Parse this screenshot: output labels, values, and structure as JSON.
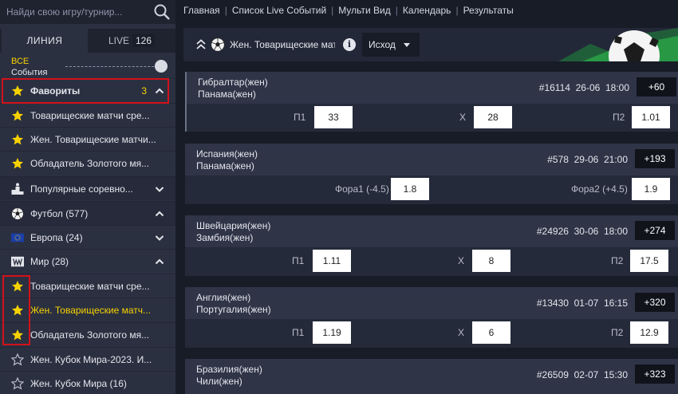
{
  "search": {
    "placeholder": "Найди свою игру/турнир..."
  },
  "tabs": {
    "line": "ЛИНИЯ",
    "live_label": "LIVE",
    "live_count": "126"
  },
  "all_events": {
    "line1": "ВСЕ",
    "line2": "События"
  },
  "sidebar": {
    "favorites": {
      "label": "Фавориты",
      "count": "3"
    },
    "items": [
      {
        "label": "Товарищеские матчи сре...",
        "icon": "star-filled-icon"
      },
      {
        "label": "Жен. Товарищеские матчи...",
        "icon": "star-filled-icon"
      },
      {
        "label": "Обладатель Золотого мя...",
        "icon": "star-filled-icon"
      },
      {
        "label": "Популярные соревно...",
        "icon": "podium-icon"
      },
      {
        "label": "Футбол (577)",
        "icon": "soccer-ball-icon"
      },
      {
        "label": "Европа (24)",
        "icon": "eu-flag-icon"
      },
      {
        "label": "Мир (28)",
        "icon": "world-flag-icon"
      },
      {
        "label": "Товарищеские матчи сре...",
        "icon": "star-filled-icon"
      },
      {
        "label": "Жен. Товарищеские матч...",
        "icon": "star-filled-icon"
      },
      {
        "label": "Обладатель Золотого мя...",
        "icon": "star-filled-icon"
      },
      {
        "label": "Жен. Кубок Мира-2023. И...",
        "icon": "star-outline-icon"
      },
      {
        "label": "Жен. Кубок Мира (16)",
        "icon": "star-outline-icon"
      }
    ]
  },
  "topnav": [
    "Главная",
    "Список Live Событий",
    "Мульти Вид",
    "Календарь",
    "Результаты"
  ],
  "main": {
    "title": "Жен. Товарищеские матч...",
    "info_glyph": "i",
    "select_value": "Исход"
  },
  "matches": [
    {
      "team1": "Гибралтар(жен)",
      "team2": "Панама(жен)",
      "id": "#16114",
      "date": "26-06",
      "time": "18:00",
      "more": "+60",
      "odds": [
        {
          "label": "П1",
          "value": "33"
        },
        {
          "label": "X",
          "value": "28"
        },
        {
          "label": "П2",
          "value": "1.01"
        }
      ]
    },
    {
      "team1": "Испания(жен)",
      "team2": "Панама(жен)",
      "id": "#578",
      "date": "29-06",
      "time": "21:00",
      "more": "+193",
      "odds": [
        {
          "label": "Фора1 (-4.5)",
          "value": "1.8"
        },
        {
          "label": "Фора2 (+4.5)",
          "value": "1.9"
        }
      ]
    },
    {
      "team1": "Швейцария(жен)",
      "team2": "Замбия(жен)",
      "id": "#24926",
      "date": "30-06",
      "time": "18:00",
      "more": "+274",
      "odds": [
        {
          "label": "П1",
          "value": "1.11"
        },
        {
          "label": "X",
          "value": "8"
        },
        {
          "label": "П2",
          "value": "17.5"
        }
      ]
    },
    {
      "team1": "Англия(жен)",
      "team2": "Португалия(жен)",
      "id": "#13430",
      "date": "01-07",
      "time": "16:15",
      "more": "+320",
      "odds": [
        {
          "label": "П1",
          "value": "1.19"
        },
        {
          "label": "X",
          "value": "6"
        },
        {
          "label": "П2",
          "value": "12.9"
        }
      ]
    },
    {
      "team1": "Бразилия(жен)",
      "team2": "Чили(жен)",
      "id": "#26509",
      "date": "02-07",
      "time": "15:30",
      "more": "+323"
    }
  ],
  "colors": {
    "accent": "#f7d200",
    "highlight": "#d3111b",
    "sidebar": "#2b3041",
    "background": "#181c27"
  }
}
